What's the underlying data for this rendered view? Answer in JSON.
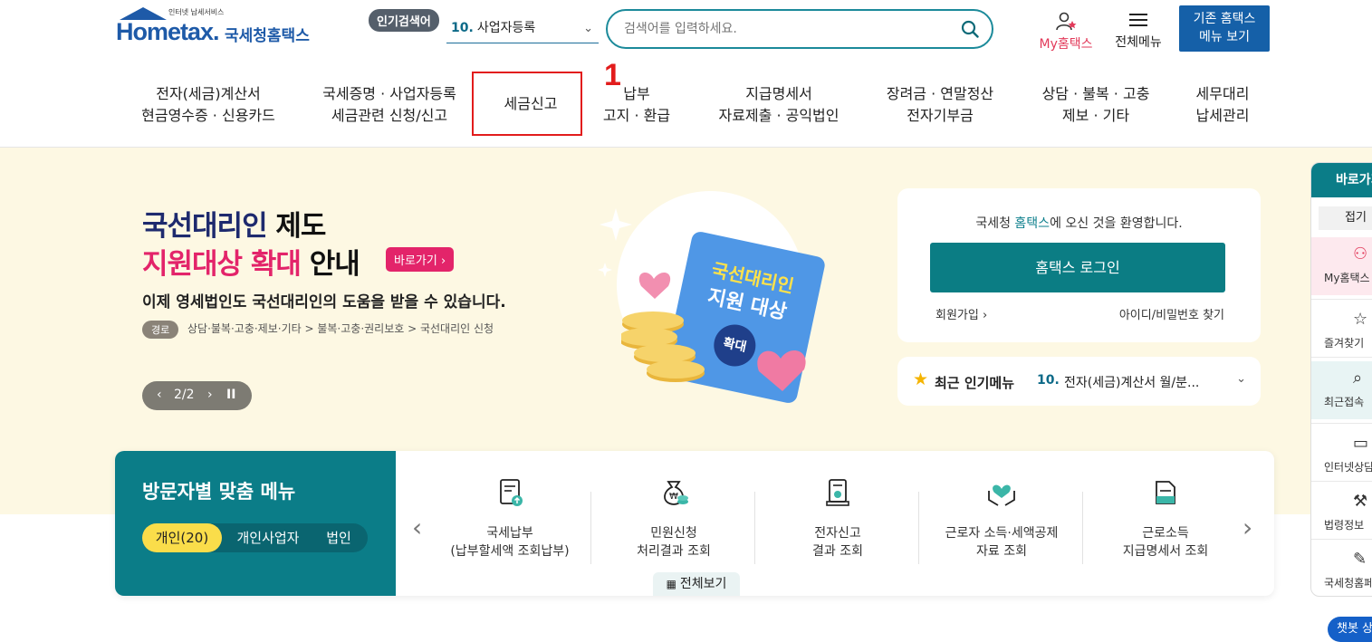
{
  "header": {
    "logo_small": "인터넷 납세서비스",
    "logo_brand": "Hometax.",
    "logo_kor": "국세청홈택스",
    "popular_badge": "인기검색어",
    "popular_num": "10.",
    "popular_value": "사업자등록",
    "search_placeholder": "검색어를 입력하세요.",
    "my_label": "My홈택스",
    "all_menu_label": "전체메뉴",
    "legacy_line1": "기존 홈택스",
    "legacy_line2": "메뉴 보기"
  },
  "nav": [
    {
      "l1": "전자(세금)계산서",
      "l2": "현금영수증 · 신용카드"
    },
    {
      "l1": "국세증명 · 사업자등록",
      "l2": "세금관련 신청/신고"
    },
    {
      "l1": "세금신고",
      "l2": ""
    },
    {
      "l1": "납부",
      "l2": "고지 · 환급"
    },
    {
      "l1": "지급명세서",
      "l2": "자료제출 · 공익법인"
    },
    {
      "l1": "장려금 · 연말정산",
      "l2": "전자기부금"
    },
    {
      "l1": "상담 · 불복 · 고충",
      "l2": "제보 · 기타"
    },
    {
      "l1": "세무대리",
      "l2": "납세관리"
    }
  ],
  "annotation_number": "1",
  "banner": {
    "title1_colored": "국선대리인",
    "title1_plain": " 제도",
    "title2_colored": "지원대상 확대",
    "title2_plain": " 안내",
    "go_button": "바로가기 ›",
    "subtitle": "이제 영세법인도 국선대리인의 도움을 받을 수 있습니다.",
    "path_badge": "경로",
    "path": "상담·불복·고충·제보·기타 > 불복·고충·권리보호 > 국선대리인 신청",
    "pager_text": "2/2",
    "book_line1": "국선대리인",
    "book_line2": "지원 대상",
    "book_badge": "확대"
  },
  "login": {
    "welcome_pre": "국세청 ",
    "welcome_brand": "홈택스",
    "welcome_post": "에 오신 것을 환영합니다.",
    "login_button": "홈택스 로그인",
    "join": "회원가입 ›",
    "find": "아이디/비밀번호 찾기"
  },
  "recent": {
    "label": "최근 인기메뉴",
    "num": "10.",
    "value": "전자(세금)계산서 월/분..."
  },
  "visitor": {
    "title": "방문자별 맞춤 메뉴",
    "tabs": [
      "개인(20)",
      "개인사업자",
      "법인"
    ],
    "items": [
      {
        "l1": "국세납부",
        "l2": "(납부할세액 조회납부)",
        "icon": "tax-payment-icon"
      },
      {
        "l1": "민원신청",
        "l2": "처리결과 조회",
        "icon": "money-bag-icon"
      },
      {
        "l1": "전자신고",
        "l2": "결과 조회",
        "icon": "e-filing-icon"
      },
      {
        "l1": "근로자 소득·세액공제",
        "l2": "자료 조회",
        "icon": "heart-hands-icon"
      },
      {
        "l1": "근로소득",
        "l2": "지급명세서 조회",
        "icon": "document-icon"
      }
    ],
    "view_all": "전체보기"
  },
  "quick": {
    "header": "바로가기",
    "fold": "접기",
    "items": [
      "My홈택스",
      "즐겨찾기",
      "최근접속",
      "인터넷상담",
      "법령정보",
      "국세청홈페이지"
    ]
  },
  "chatbot": "챗봇 상담"
}
